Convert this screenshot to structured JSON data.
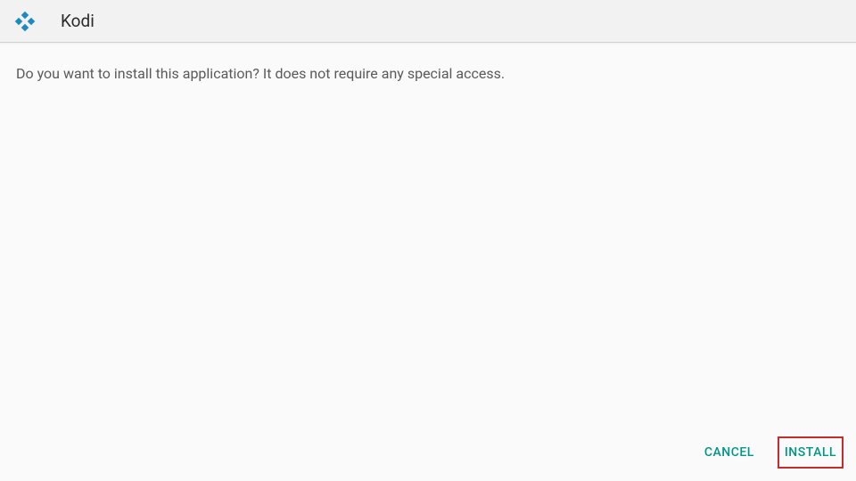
{
  "header": {
    "app_name": "Kodi",
    "icon_name": "kodi-logo-icon"
  },
  "content": {
    "prompt": "Do you want to install this application? It does not require any special access."
  },
  "footer": {
    "cancel_label": "CANCEL",
    "install_label": "INSTALL"
  },
  "colors": {
    "accent": "#009688",
    "highlight_border": "#c92a2a"
  }
}
